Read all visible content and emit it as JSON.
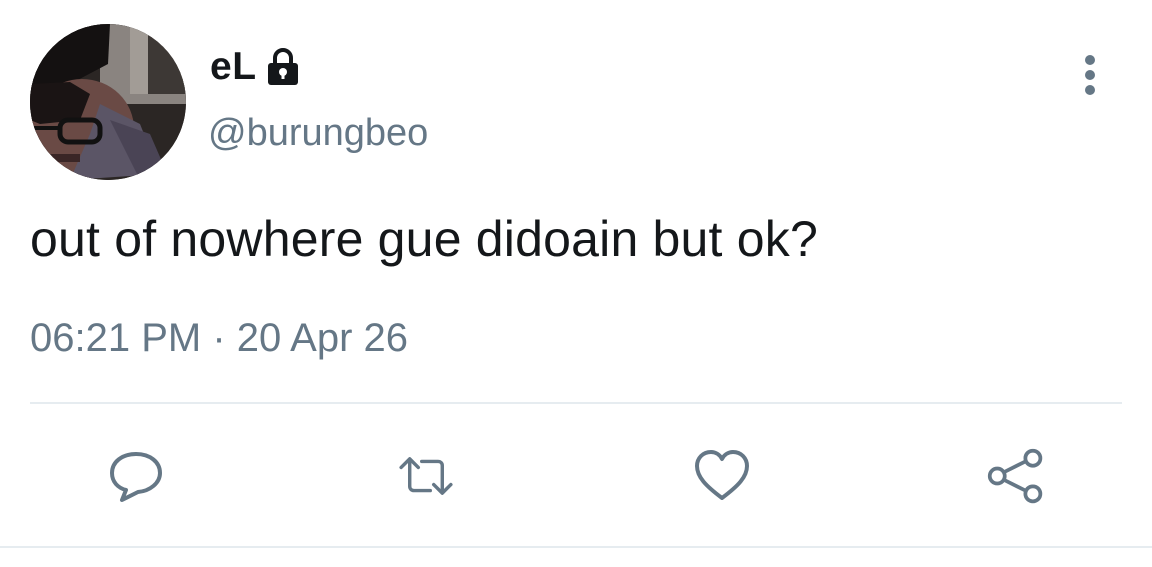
{
  "user": {
    "display_name": "eL",
    "handle": "@burungbeo",
    "protected_icon": "lock-icon",
    "avatar": "profile-photo"
  },
  "tweet": {
    "text": "out of nowhere gue didoain but ok?",
    "timestamp": "06:21 PM · 20 Apr 26"
  },
  "actions": [
    {
      "name": "reply",
      "icon": "comment-icon"
    },
    {
      "name": "retweet",
      "icon": "retweet-icon"
    },
    {
      "name": "like",
      "icon": "heart-icon"
    },
    {
      "name": "share",
      "icon": "share-icon"
    }
  ],
  "menu": {
    "icon": "more-vertical-icon"
  },
  "colors": {
    "text": "#14171a",
    "secondary": "#657786",
    "divider": "#e6ecf0",
    "background": "#ffffff"
  }
}
